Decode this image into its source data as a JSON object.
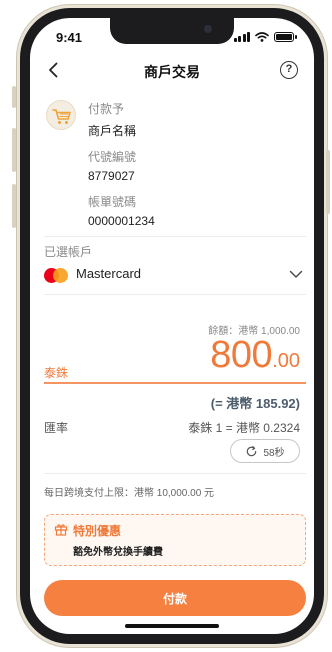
{
  "status_bar": {
    "time": "9:41"
  },
  "header": {
    "title": "商戶交易",
    "help_label": "?"
  },
  "merchant": {
    "payee_label": "付款予",
    "payee_value": "商戶名稱",
    "code_label": "代號編號",
    "code_value": "8779027",
    "bill_label": "帳單號碼",
    "bill_value": "0000001234",
    "icon": "shopping-cart-icon"
  },
  "account": {
    "section_label": "已選帳戶",
    "card_name": "Mastercard",
    "balance": "餘額：港幣 1,000.00"
  },
  "payment": {
    "currency_label": "泰銖",
    "amount_integer": "800",
    "amount_decimal": ".00",
    "converted": "(= 港幣 185.92)",
    "rate_label": "匯率",
    "rate_value": "泰銖 1 = 港幣 0.2324",
    "refresh_countdown": "58秒",
    "daily_limit": "每日跨境支付上限：港幣 10,000.00 元"
  },
  "offer": {
    "title": "特別優惠",
    "description": "豁免外幣兌換手續費"
  },
  "actions": {
    "pay_label": "付款"
  },
  "colors": {
    "accent": "#f5803f",
    "accent_text": "#f07a3a",
    "converted_text": "#4d5c6b"
  }
}
